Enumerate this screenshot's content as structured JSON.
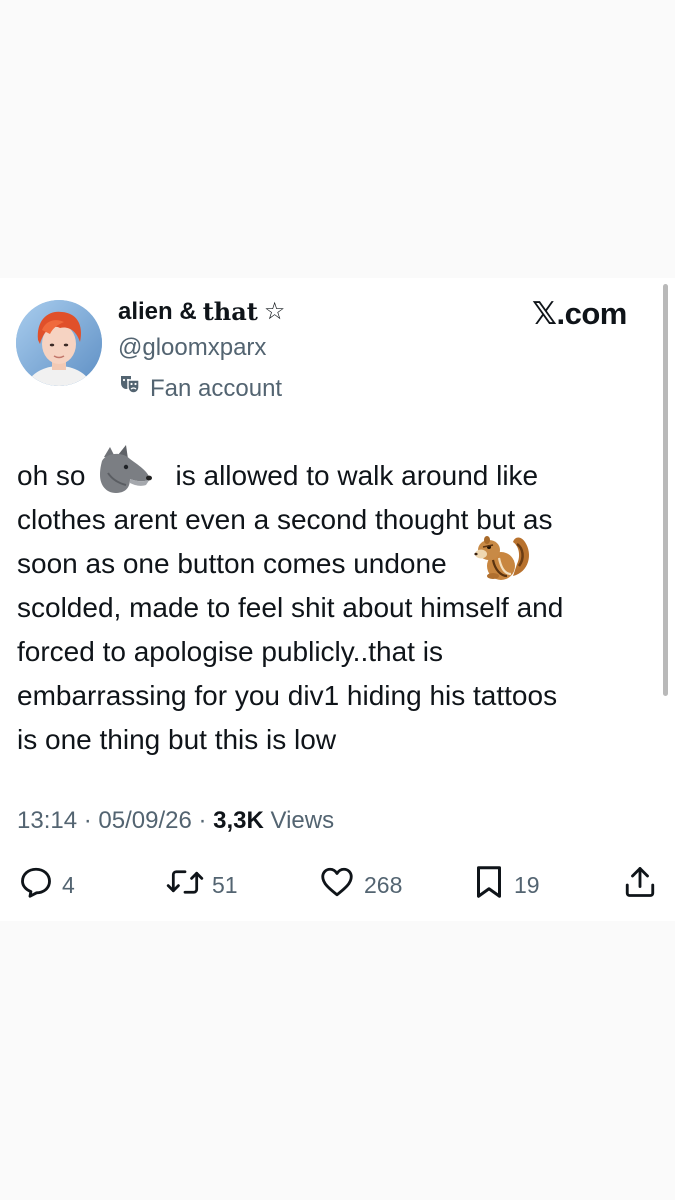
{
  "author": {
    "display_name_plain": "alien &",
    "display_name_styled": "that",
    "display_name_symbol": "☆",
    "handle": "@gloomxparx",
    "label": "Fan account",
    "label_icon": "theater-masks-icon"
  },
  "brand": {
    "x_glyph": "𝕏",
    "domain": ".com"
  },
  "tweet": {
    "lines": [
      [
        "oh so",
        "is allowed to walk around like"
      ],
      [
        "clothes arent even a second thought but as"
      ],
      [
        "soon as one button comes undone"
      ],
      [
        "scolded, made to feel shit about himself and"
      ],
      [
        "forced to apologise publicly..that is"
      ],
      [
        "embarrassing for you div1 hiding his tattoos"
      ],
      [
        "is one thing but this is low"
      ]
    ],
    "emojis": [
      "wolf-emoji",
      "chipmunk-emoji"
    ]
  },
  "meta": {
    "time": "13:14",
    "sep1": " · ",
    "date": "05/09/26",
    "sep2": " · ",
    "views_count": "3,3K",
    "views_label": "Views"
  },
  "actions": {
    "replies": "4",
    "reposts": "51",
    "likes": "268",
    "bookmarks": "19"
  },
  "colors": {
    "text": "#0f1419",
    "secondary": "#536471",
    "background": "#ffffff",
    "page": "#fafafa"
  }
}
